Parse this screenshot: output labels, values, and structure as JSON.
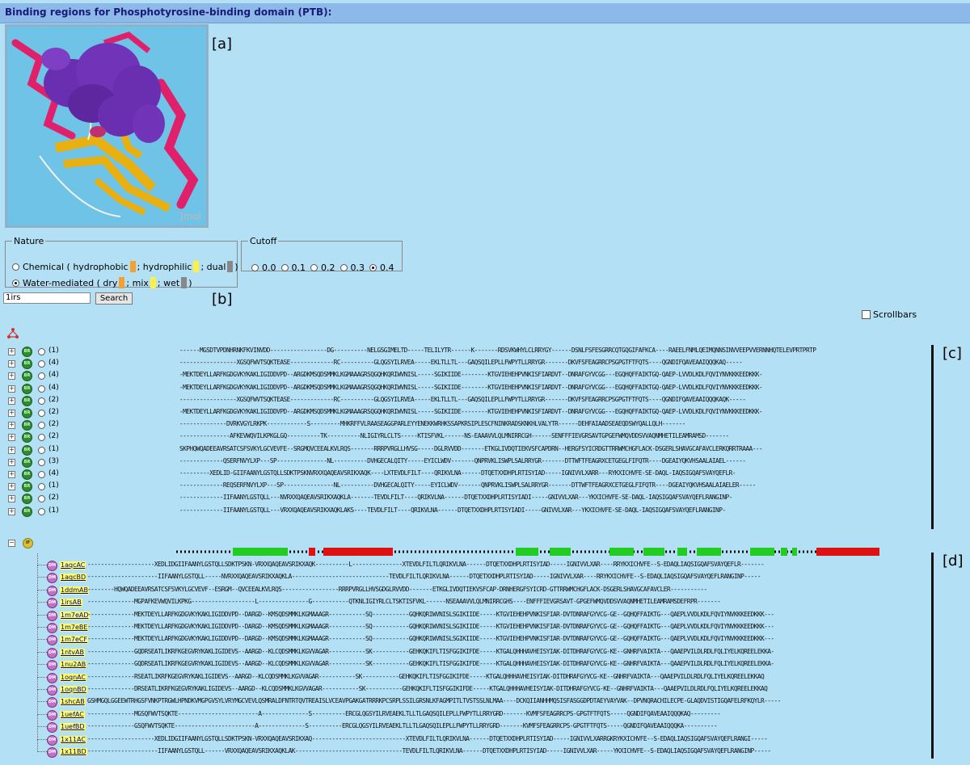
{
  "title": "Binding regions for Phosphotyrosine-binding domain (PTB):",
  "viewer": {
    "logo": "Jmol"
  },
  "panel_labels": {
    "a": "[a]",
    "b": "[b]",
    "c": "[c]",
    "d": "[d]"
  },
  "nature": {
    "legend": "Nature",
    "chemical": {
      "label_pre": "Chemical ( hydrophobic",
      "mid1": "; hydrophilic",
      "mid2": "; dual",
      "end": ")",
      "selected": false
    },
    "water": {
      "label_pre": "Water-mediated ( dry",
      "mid1": "; mix",
      "mid2": "; wet",
      "end": ")",
      "selected": true
    }
  },
  "cutoff": {
    "legend": "Cutoff",
    "options": [
      "0.0",
      "0.1",
      "0.2",
      "0.3",
      "0.4"
    ],
    "selected": "0.4"
  },
  "search": {
    "value": "1irs",
    "button": "Search"
  },
  "scrollbars": {
    "label": "Scrollbars",
    "checked": false
  },
  "colors": {
    "hydrophobic": "#f5a030",
    "hydrophilic": "#fff044",
    "dual": "#888888",
    "strand": "#22cc22",
    "helix": "#dd1111"
  },
  "icons": {
    "tree": "structure-tree-icon",
    "br": "br-badge-icon",
    "dm": "dm-badge-icon",
    "if": "if-badge-icon"
  },
  "binding_regions": [
    {
      "badge": "BR",
      "count": "(1)",
      "seq": "------MGSDTVPDNHRNKFKVINVDD-----------------DG----------NELGSGIMELTD-----TELILYTR------K-------RDSVKWHYLCLRRYGY------DSNLFSFESGRRCQTGQGIFAFKCA----RAEELFNMLQEIMQNNSINVVEEPVVERNNHQTELEVPRTPRTP"
    },
    {
      "badge": "BR",
      "count": "(4)",
      "seq": "-----------------XGSQFWVTSQKTEASE-------------RC----------GLQGSYILRVEA-----EKLTLLTL---GAQSQILEPLLFWPYTLLRRYGR-------DKVFSFEAGRRCPSGPGTFTFQTS----QGNDIFQAVEAAIQQQKAQ-----"
    },
    {
      "badge": "BR",
      "count": "(4)",
      "seq": "-MEKTDEYLLARFKGDGVKYKAKLIGIDDVPD--ARGDKMSQDSMMKLKGMAAAGRSQGQHKQRIWVNISL-----SGIKIIDE--------KTGVIEHEHPVNKISFIARDVT--DNRAFGYVCGG---EGQHQFFAIKTGQ-QAEP-LVVDLKDLFQVIYNVKKKEEDKKK-"
    },
    {
      "badge": "BR",
      "count": "(4)",
      "seq": "-MEKTDEYLLARFKGDGVKYKAKLIGIDDVPD--ARGDKMSQDSMMKLKGMAAAGRSQGQHKQRIWVNISL-----SGIKIIDE--------KTGVIEHEHPVNKISFIARDVT--DNRAFGYVCGG---EGQHQFFAIKTGQ-QAEP-LVVDLKDLFQVIYNVKKKEEDKKK-"
    },
    {
      "badge": "BR",
      "count": "(2)",
      "seq": "-----------------XGSQFWVTSQKTEASE-------------RC----------GLQGSYILRVEA-----EKLTLLTL---GAQSQILEPLLFWPYTLLRRYGR-------DKVFSFEAGRRCPSGPGTFTFQTS----QGNDIFQAVEAAIQQQKAQK-----"
    },
    {
      "badge": "BR",
      "count": "(2)",
      "seq": "-MEKTDEYLLARFKGDGVKYKAKLIGIDDVPD--ARGDKMSQDSMMKLKGMAAAGRSQGQHKQRIWVNISL-----SGIKIIDE--------KTGVIEHEHPVNKISFIARDVT--DNRAFGYVCGG---EGQHQFFAIKTGQ-QAEP-LVVDLKDLFQVIYNVKKKEEDKKK-"
    },
    {
      "badge": "BR",
      "count": "(2)",
      "seq": "--------------DVRKVGYLRKPK------------S---------MHKRFFVLRAASEAGGPARLEYYENEKKWRHKSSAPKRSIPLESCFNINKRADSKNKHLVALYTR------DEHFAIAADSEAEQDSWYQALLQLH-------"
    },
    {
      "badge": "BR",
      "count": "(2)",
      "seq": "---------------AFKEVWQVILKPKGLGQ----------TK----------NLIGIYRLCLTS-----KTISFVKL------NS-EAAAVVLQLMNIRRCGH------SENFFFIEVGRSAVTGPGEFWMQVDDSVVAQNMHETILEAMRAMSD-------"
    },
    {
      "badge": "BR",
      "count": "(1)",
      "seq": "SKPHQWQADEEAVRSATCSFSVKYLGCVEVFE--SRGMQVCEEALKVLRQS-------RRRPVRGLLHVSG-----DGLRVVDD-------ETKGLIVDQTIEKVSFCAPDRN--HERGFSYICRDGTTRRWMCHGFLACK-DSGERLSHAVGCAFAVCLERKQRRTRAAA---"
    },
    {
      "badge": "BR",
      "count": "(3)",
      "seq": "-------------QSERFNVYLXP---SP---------------NL----------DVHGECALQITY-----EYICLWDV-------QNPRVKLISWPLSALRRYGR-------DTTWFTFEAGRXCETGEGLFIFQTR----DGEAIYQKVHSAALAIAEL------"
    },
    {
      "badge": "BR",
      "count": "(4)",
      "seq": "---------XEDLID-GIIFAANYLGSTQLLSDKTPSKNVRXXQAQEAVSRIKXAQK----LXTEVDLFILT----QRIKVLNA------DTQETXXDHPLRTISYIAD-----IGNIVVLXARR---RYKXICHVFE-SE-DAQL-IAQSIGQAFSVAYQEFLR-"
    },
    {
      "badge": "BR",
      "count": "(1)",
      "seq": "-------------REQSERFNVYLXP---SP---------------NL----------DVHGECALQITY-----EYICLWDV-------QNPRVKLISWPLSALRRYGR-------DTTWFTFEAGRXCETGEGLFIFQTR----DGEAIYQKVHSAALAIAELER-----"
    },
    {
      "badge": "BR",
      "count": "(2)",
      "seq": "-------------IIFAANYLGSTQLL---NVRXXQAQEAVSRIKXAQKLA-------TEVDLFILT----QRIKVLNA------DTQETXXDHPLRTISYIADI-----GNIVVLXAR---YKXICHVFE-SE-DAQL-IAQSIGQAFSVAYQEFLRANGINP-"
    },
    {
      "badge": "BR",
      "count": "(1)",
      "seq": "-------------IIFAANYLGSTQLL---VRXXQAQEAVSRIKXAQKLAKS----TEVDLFILT----QRIKVLNA------DTQETXXDHPLRTISYIADI-----GNIVVLXAR---YKXICHVFE-SE-DAQL-IAQSIGQAFSVAYQEFLRANGINP-"
    }
  ],
  "interface": {
    "badge": "IF"
  },
  "domains": [
    {
      "pdb": "1aqcAC",
      "seq": "--------------------XEDLIDGIIFAANYLGSTQLLSDKTPSKN-VRXXQAQEAVSRIKXAQK----------L---------------XTEVDLFILTLQRIKVLNA------DTQETXXDHPLRTISYIAD-----IGNIVVLXAR----RRYKXICHVFE--S-EDAQLIAQSIGQAFSVAYQEFLR-------"
    },
    {
      "pdb": "1aqcBD",
      "seq": "---------------------IIFAANYLGSTQLL-----NVRXXQAQEAVSRIKXAQKLA-----------------------------TEVDLFILTLQRIKVLNA------DTQETXXDHPLRTISYIAD-----IGNIVVLXAR----RRYKXICHVFE--S-EDAQLIAQSIGQAFSVAYQEFLRANGINP-----"
    },
    {
      "pdb": "1ddmAB",
      "seq": "--------HQWQADEEAVRSATCSFSVKYLGCVEVF--ESRGM--QVCEEALKVLRQS-----------------RRRPVRGLLHVSGDGLRVVDD-------ETKGLIVDQTIEKVSFCAP-DRNHERGFSYICRD-GTTRRWMCHGFLACK-DSGERLSHAVGCAFAVCLER-----------"
    },
    {
      "pdb": "1irsAB",
      "seq": "--------------MGPAFKEVWQVILKPKG-------------------L---------------G-----------QTKNLIGIYRLCLTSKTISFVKL------NSEAAAVVLQLMNIRRCGHS----ENFFFIEVGRSAVT-GPGEFWMQVDDSVVAQNMHETILEAMRAMSDEFRPR-------"
    },
    {
      "pdb": "1m7eAD",
      "seq": "--------------MEKTDEYLLARFKGDGVKYKAKLIGIDDVPD--DARGD--KMSQDSMMKLKGMAAAGR-----------SQ-----------GQHKQRIWVNISLSGIKIIDE-----KTGVIEHEHPVNKISFIAR-DVTDNRAFGYVCG-GE--GQHQFFAIKTG---QAEPLVVDLKDLFQVIYNVKKKEEDKKK---"
    },
    {
      "pdb": "1m7eBE",
      "seq": "--------------MEKTDEYLLARFKGDGVKYKAKLIGIDDVPD--DARGD--KMSQDSMMKLKGMAAAGR-----------SQ-----------GQHKQRIWVNISLSGIKIIDE-----KTGVIEHEHPVNKISFIAR-DVTDNRAFGYVCG-GE--GQHQFFAIKTG---QAEPLVVDLKDLFQVIYNVKKKEEDKKK---"
    },
    {
      "pdb": "1m7eCF",
      "seq": "--------------MEKTDEYLLARFKGDGVKYKAKLIGIDDVPD--DARGD--KMSQDSMMKLKGMAAAGR-----------SQ-----------GQHKQRIWVNISLSGIKIIDE-----KTGVIEHEHPVNKISFIAR-DVTDNRAFGYVCG-GE--GQHQFFAIKTG---QAEPLVVDLKDLFQVIYNVKKKEEDKKK---"
    },
    {
      "pdb": "1ntvAB",
      "seq": "--------------GQDRSEATLIKRFKGEGVRYKAKLIGIDEVS--AARGD--KLCQDSMMKLKGVVAGAR-----------SK-----------GEHKQKIFLTISFGGIKIFDE-----KTGALQHHHAVHEISYIAK-DITDHRAFGYVCG-KE--GNHRFVAIKTA---QAAEPVILDLRDLFQLIYELKQREELEKKA-"
    },
    {
      "pdb": "1nu2AB",
      "seq": "--------------GQDRSEATLIKRFKGEGVRYKAKLIGIDEVS--AARGD--KLCQDSMMKLKGVVAGAR-----------SK-----------GEHKQKIFLTISFGGIKIFDE-----KTGALQHHHAVHEISYIAK-DITDHRAFGYVCG-KE--GNHRFVAIKTA---QAAEPVILDLRDLFQLIYELKQREELEKKA-"
    },
    {
      "pdb": "1oqnAC",
      "seq": "--------------RSEATLIKRFKGEGVRYKAKLIGIDEVS--AARGD--KLCQDSMMKLKGVVAGAR-----------SK-----------GEHKQKIFLTISFGGIKIFDE-----KTGALQHHHAVHEISYIAK-DITDHRAFGYVCG-KE--GNHRFVAIKTA---QAAEPVILDLRDLFQLIYELKQREELEKKAQ"
    },
    {
      "pdb": "1oqnBD",
      "seq": "--------------DRSEATLIKRFKGEGVRYKAKLIGIDEVS--AARGD--KLCQDSMMKLKGVVAGAR-----------SK-----------GEHKQKIFLTISFGGIKIFDE-----KTGALQHHHAVHEISYIAK-DITDHRAFGYVCG-KE--GNHRFVAIKTA---QAAEPVILDLRDLFQLIYELKQREELEKKAQ"
    },
    {
      "pdb": "1shcAB",
      "seq": "GSHMGQLGGEEWTRHGSFVNKPTRGWLHPNDKVMGPGVSYLVRYMGCVEVLQSMRALDFNTRTQVTREAISLVCEAVPGAKGATRRRKPCSRPLSSILGRSNLKFAGMPITLTVSTSSLNLMAA----DCKQIIANHHMQSISFASGGDPDTAEYVAYVAK--DPVNQRACHILECPE-GLAQDVISTIGQAFELRFKQYLR-----"
    },
    {
      "pdb": "1uefAC",
      "seq": "--------------MGSQFWVTSQKTE------------------------A--------------S----------ERCGLQGSYILRVEAEKLTLLTLGAQSQILEPLLFWPYTLLRRYGRD-------KVMFSFEAGRRCPS-GPGTFTFQTS-----QGNDIFQAVEAAIQQQKAQ---------"
    },
    {
      "pdb": "1uefBD",
      "seq": "--------------GSQFWVTSQKTE------------------------A--------------S----------ERCGLQGSYILRVEAEKLTLLTLGAQSQILEPLLFWPYTLLRRYGRD-------KVMFSFEAGRRCPS-GPGTFTFQTS-----QGNDIFQAVEAAIQQQKA----------"
    },
    {
      "pdb": "1x11AC",
      "seq": "--------------------XEDLIDGIIFAANYLGSTQLLSDKTPSKN-VRXXQAQEAVSRIKXAQ----------------------------XTEVDLFILTLQRIKVLNA------DTQETXXDHPLRTISYIAD-----IGNIVVLXARRGKRYKXICHVFE--S-EDAQLIAQSIGQAFSVAYQEFLRANGI-----"
    },
    {
      "pdb": "1x11BD",
      "seq": "---------------------IIFAANYLGSTQLL------VRXXQAQEAVSRIKXAQKLAK--------------------------------TEVDLFILTLQRIKVLNA------DTQETXXDHPLRTISYIAD-----IGNIVVLXAR-----YKXICHVFE--S-EDAQLIAQSIGQAFSVAYQEFLRANGINP-----"
    }
  ]
}
